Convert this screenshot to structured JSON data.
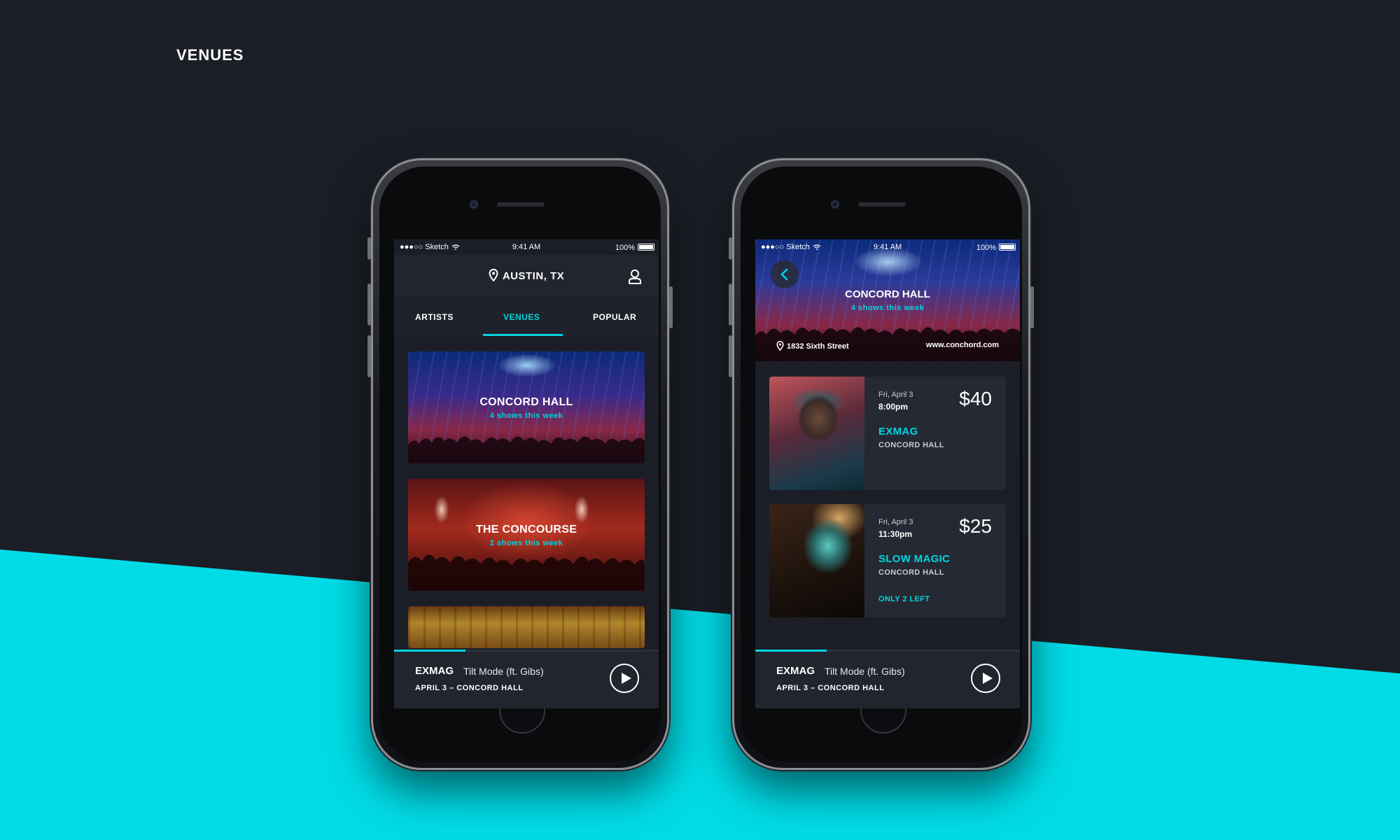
{
  "page": {
    "title": "VENUES"
  },
  "colors": {
    "background": "#1b1e26",
    "accent": "#00d5e2",
    "band": "#00dbe6"
  },
  "status_bar": {
    "carrier": "●●●○○ Sketch",
    "time": "9:41 AM",
    "battery": "100%"
  },
  "venues_screen": {
    "location": "AUSTIN, TX",
    "tabs": [
      {
        "label": "ARTISTS"
      },
      {
        "label": "VENUES",
        "active": true
      },
      {
        "label": "POPULAR"
      }
    ],
    "venues": [
      {
        "name": "CONCORD HALL",
        "shows": "4 shows this week"
      },
      {
        "name": "THE CONCOURSE",
        "shows": "2 shows this week"
      }
    ]
  },
  "venue_detail": {
    "name": "CONCORD HALL",
    "shows": "4 shows this week",
    "address": "1832 Sixth Street",
    "website": "www.conchord.com",
    "events": [
      {
        "date": "Fri, April 3",
        "time": "8:00pm",
        "price": "$40",
        "artist": "EXMAG",
        "venue": "CONCORD HALL",
        "alert": ""
      },
      {
        "date": "Fri, April 3",
        "time": "11:30pm",
        "price": "$25",
        "artist": "SLOW MAGIC",
        "venue": "CONCORD HALL",
        "alert": "ONLY 2 LEFT"
      }
    ]
  },
  "player": {
    "artist": "EXMAG",
    "track": "Tilt Mode (ft. Gibs)",
    "meta": "APRIL 3 – CONCORD HALL",
    "progress_fraction": 0.27
  }
}
